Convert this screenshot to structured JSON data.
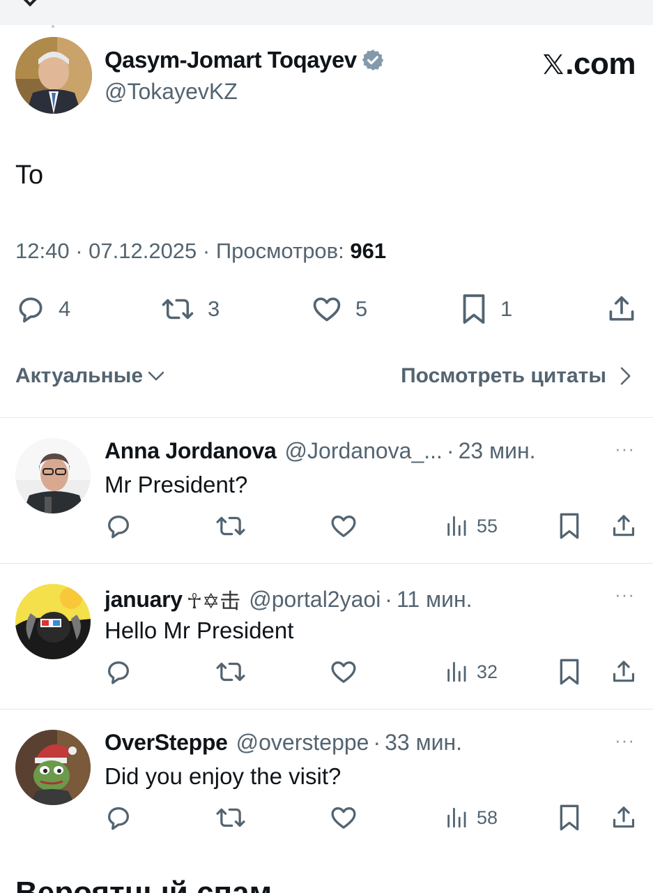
{
  "tweet": {
    "author_name": "Qasym-Jomart Toqayev",
    "author_handle": "@TokayevKZ",
    "verified": true,
    "site_label": ".com",
    "text": "To",
    "time": "12:40",
    "date": "07.12.2025",
    "views_label": "Просмотров:",
    "views": "961",
    "stats": {
      "replies": "4",
      "reposts": "3",
      "likes": "5",
      "bookmarks": "1"
    }
  },
  "filter": {
    "sort_label": "Актуальные",
    "quotes_label": "Посмотреть цитаты"
  },
  "replies": [
    {
      "name": "Anna Jordanova",
      "emoji": "",
      "handle": "@Jordanova_...",
      "time": "23 мин.",
      "text": "Mr President?",
      "views": "55",
      "more": "···"
    },
    {
      "name": "january",
      "emoji": "☥✡击",
      "handle": "@portal2yaoi",
      "time": "11 мин.",
      "text": "Hello Mr President",
      "views": "32",
      "more": "···"
    },
    {
      "name": "OverSteppe",
      "emoji": "",
      "handle": "@oversteppe",
      "time": "33 мин.",
      "text": "Did you enjoy the visit?",
      "views": "58",
      "more": "···"
    }
  ],
  "spam_section_title": "Вероятный спам",
  "colors": {
    "text_primary": "#0f1419",
    "text_secondary": "#536471",
    "verified_badge": "#829aab",
    "divider": "#e5e7ea"
  },
  "icons": [
    "chevron-icon",
    "verified-badge-icon",
    "x-logo-icon",
    "reply-icon",
    "repost-icon",
    "like-icon",
    "bookmark-icon",
    "share-icon",
    "views-icon",
    "chevron-down-icon",
    "chevron-right-icon",
    "more-icon"
  ]
}
